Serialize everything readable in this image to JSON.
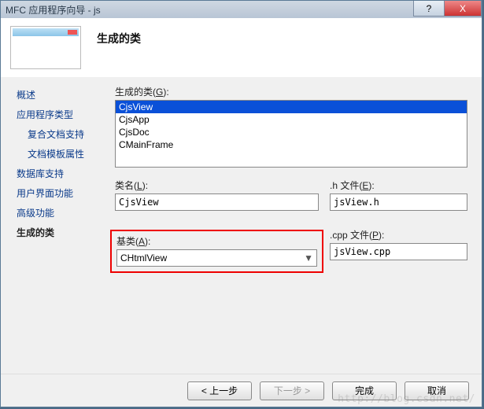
{
  "titlebar": {
    "text": "MFC 应用程序向导 - js",
    "help_symbol": "?",
    "close_symbol": "X"
  },
  "header": {
    "title": "生成的类"
  },
  "sidebar": {
    "items": [
      {
        "label": "概述",
        "indent": false
      },
      {
        "label": "应用程序类型",
        "indent": false
      },
      {
        "label": "复合文档支持",
        "indent": true
      },
      {
        "label": "文档模板属性",
        "indent": true
      },
      {
        "label": "数据库支持",
        "indent": false
      },
      {
        "label": "用户界面功能",
        "indent": false
      },
      {
        "label": "高级功能",
        "indent": false
      },
      {
        "label": "生成的类",
        "indent": false,
        "active": true
      }
    ]
  },
  "main": {
    "generated_classes_label_pre": "生成的类",
    "generated_classes_label_key": "G",
    "list_items": [
      "CjsView",
      "CjsApp",
      "CjsDoc",
      "CMainFrame"
    ],
    "class_name_label_pre": "类名",
    "class_name_label_key": "L",
    "class_name_value": "CjsView",
    "hfile_label_pre": ".h 文件",
    "hfile_label_key": "E",
    "hfile_value": "jsView.h",
    "base_class_label_pre": "基类",
    "base_class_label_key": "A",
    "base_class_value": "CHtmlView",
    "cppfile_label_pre": ".cpp 文件",
    "cppfile_label_key": "P",
    "cppfile_value": "jsView.cpp"
  },
  "footer": {
    "prev": "< 上一步",
    "next": "下一步 >",
    "finish": "完成",
    "cancel": "取消"
  },
  "watermark": "http://blog.csdn.net/"
}
